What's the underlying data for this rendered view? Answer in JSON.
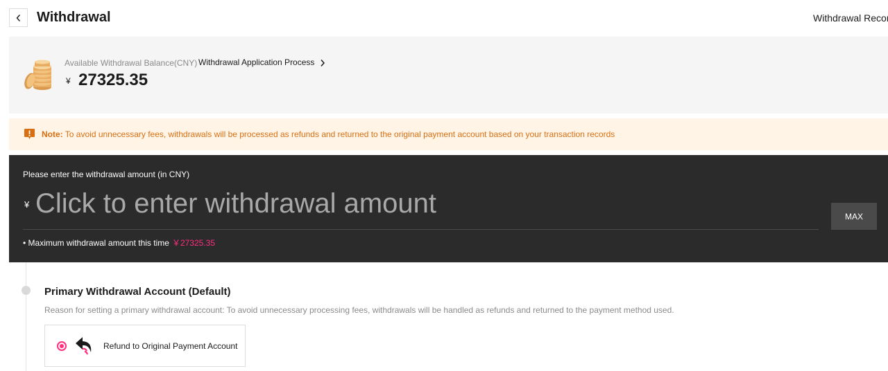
{
  "header": {
    "title": "Withdrawal",
    "records_link": "Withdrawal Record"
  },
  "balance": {
    "label": "Available Withdrawal Balance(CNY)",
    "process_link": "Withdrawal Application Process",
    "currency_symbol": "¥",
    "amount": "27325.35"
  },
  "note": {
    "prefix": "Note:",
    "text": "To avoid unnecessary fees, withdrawals will be processed as refunds and returned to the original payment account based on your transaction records"
  },
  "amount_entry": {
    "title": "Please enter the withdrawal amount (in CNY)",
    "currency_symbol": "¥",
    "placeholder": "Click to enter withdrawal amount",
    "value": "",
    "max_button": "MAX",
    "max_label": "• Maximum withdrawal amount this time",
    "max_value": "￥27325.35"
  },
  "account": {
    "title": "Primary Withdrawal Account (Default)",
    "reason": "Reason for setting a primary withdrawal account: To avoid unnecessary processing fees, withdrawals will be handled as refunds and returned to the payment method used.",
    "option_label": "Refund to Original Payment Account",
    "option_selected": true,
    "option_icon": "refund-arrow-icon"
  },
  "colors": {
    "accent": "#ff2e7e",
    "note_text": "#d86f12",
    "note_bg": "#fff4e6",
    "dark_panel": "#2b2b2b"
  }
}
